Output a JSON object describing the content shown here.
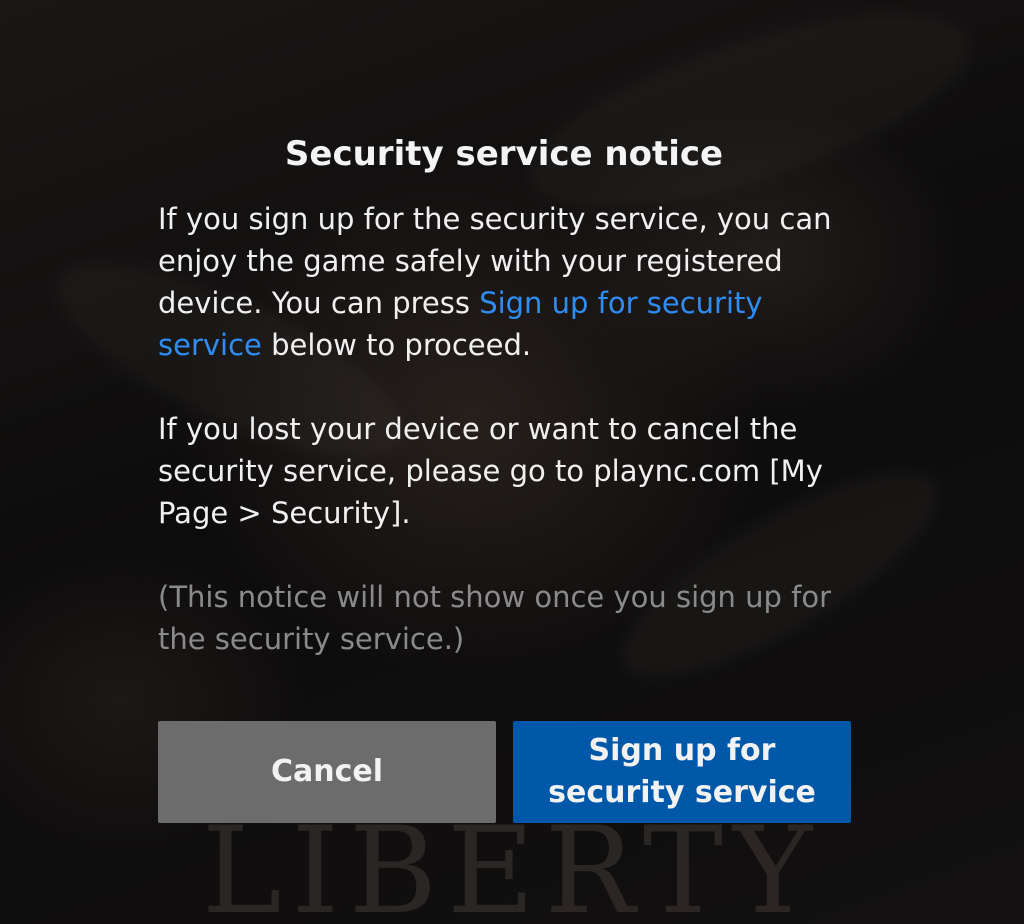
{
  "dialog": {
    "title": "Security service notice",
    "para1_prefix": "If you sign up for the security service, you can enjoy the game safely with your registered device. You can press ",
    "para1_link": "Sign up for security service",
    "para1_suffix": " below to proceed.",
    "para2": "If you lost your device or want to cancel the security service, please go to plaync.com [My Page > Security].",
    "para3": "(This notice will not show once you sign up for the security service.)"
  },
  "buttons": {
    "cancel_label": "Cancel",
    "signup_label": "Sign up for security service"
  },
  "background": {
    "art_text": "LIBERTY"
  },
  "colors": {
    "link": "#2f8cf2",
    "primary_button": "#0158a8",
    "secondary_button": "#6c6c6c",
    "muted_text": "#8a8a8a"
  }
}
